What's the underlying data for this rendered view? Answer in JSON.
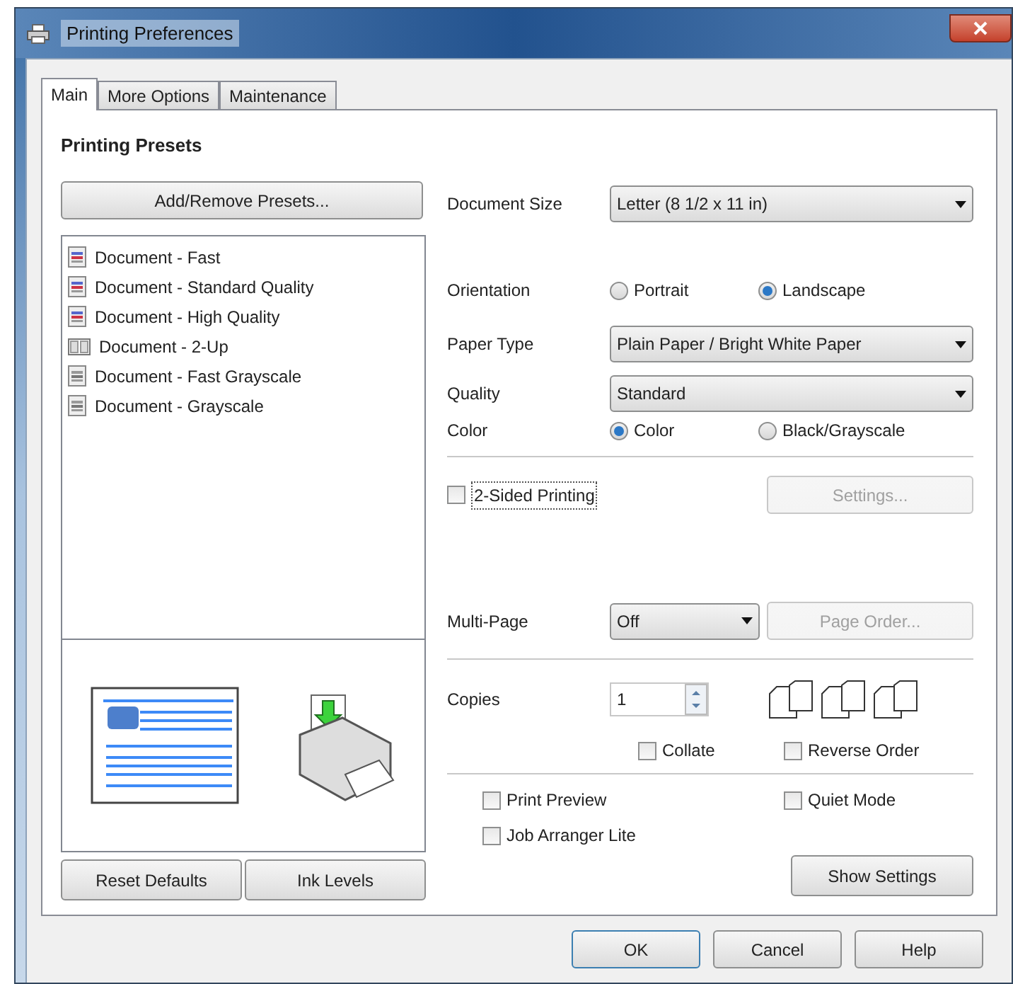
{
  "window": {
    "title": "Printing Preferences"
  },
  "tabs": [
    {
      "label": "Main",
      "selected": true
    },
    {
      "label": "More Options",
      "selected": false
    },
    {
      "label": "Maintenance",
      "selected": false
    }
  ],
  "presets": {
    "heading": "Printing Presets",
    "add_button": "Add/Remove Presets...",
    "items": [
      {
        "label": "Document - Fast",
        "kind": "color"
      },
      {
        "label": "Document - Standard Quality",
        "kind": "color"
      },
      {
        "label": "Document - High Quality",
        "kind": "color"
      },
      {
        "label": "Document - 2-Up",
        "kind": "twoup"
      },
      {
        "label": "Document - Fast Grayscale",
        "kind": "gray"
      },
      {
        "label": "Document - Grayscale",
        "kind": "gray"
      }
    ]
  },
  "left_buttons": [
    "Reset Defaults",
    "Ink Levels"
  ],
  "document_size": {
    "label": "Document Size",
    "value": "Letter (8 1/2 x 11 in)"
  },
  "orientation": {
    "label": "Orientation",
    "options": [
      {
        "label": "Portrait",
        "selected": false
      },
      {
        "label": "Landscape",
        "selected": true
      }
    ]
  },
  "paper_type": {
    "label": "Paper Type",
    "value": "Plain Paper / Bright White Paper"
  },
  "quality": {
    "label": "Quality",
    "value": "Standard"
  },
  "color": {
    "label": "Color",
    "options": [
      {
        "label": "Color",
        "selected": true
      },
      {
        "label": "Black/Grayscale",
        "selected": false
      }
    ]
  },
  "two_sided": {
    "label": "2-Sided Printing",
    "checked": false
  },
  "settings_button": {
    "label": "Settings...",
    "disabled": true
  },
  "multi_page": {
    "label": "Multi-Page",
    "value": "Off"
  },
  "page_order_button": {
    "label": "Page Order...",
    "disabled": true
  },
  "copies": {
    "label": "Copies",
    "value": "1"
  },
  "collate": {
    "label": "Collate",
    "checked": false
  },
  "reverse_order": {
    "label": "Reverse Order",
    "checked": false
  },
  "print_preview": {
    "label": "Print Preview",
    "checked": false
  },
  "job_arranger": {
    "label": "Job Arranger Lite",
    "checked": false
  },
  "quiet_mode": {
    "label": "Quiet Mode",
    "checked": false
  },
  "show_settings": "Show Settings",
  "dialog_buttons": [
    {
      "label": "OK",
      "default": true
    },
    {
      "label": "Cancel",
      "default": false
    },
    {
      "label": "Help",
      "default": false
    }
  ]
}
